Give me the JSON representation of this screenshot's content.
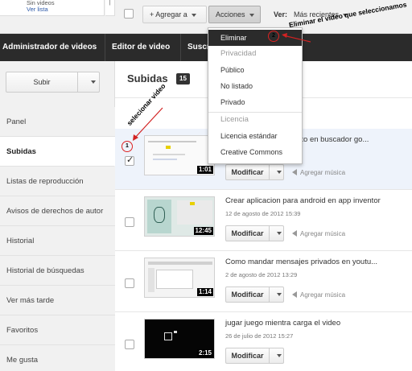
{
  "top_left": {
    "line1": "Sin videos",
    "line2": "Ver lista"
  },
  "toolbar": {
    "add_label": "+ Agregar a",
    "actions_label": "Acciones",
    "view_label": "Ver:",
    "sort_label": "Más recientes"
  },
  "nav": {
    "items": [
      "Administrador de videos",
      "Editor de video",
      "Suscr"
    ]
  },
  "sidebar": {
    "upload_label": "Subir",
    "items": [
      "Panel",
      "Subidas",
      "Listas de reproducción",
      "Avisos de derechos de autor",
      "Historial",
      "Historial de búsquedas",
      "Ver más tarde",
      "Favoritos",
      "Me gusta"
    ],
    "active_index": 1
  },
  "main": {
    "title": "Subidas",
    "count": "15",
    "videos": [
      {
        "title": "ulto en buscador go...",
        "date": "",
        "duration": "1:01",
        "modify_label": "Modificar",
        "music_label": "Agregar música",
        "checked": true
      },
      {
        "title": "Crear aplicacion para android en app inventor",
        "date": "12 de agosto de 2012 15:39",
        "duration": "12:45",
        "modify_label": "Modificar",
        "music_label": "Agregar música",
        "checked": false
      },
      {
        "title": "Como mandar mensajes privados en youtu...",
        "date": "2 de agosto de 2012 13:29",
        "duration": "1:14",
        "modify_label": "Modificar",
        "music_label": "Agregar música",
        "checked": false
      },
      {
        "title": "jugar juego mientra carga el video",
        "date": "26 de julio de 2012 15:27",
        "duration": "2:15",
        "modify_label": "Modificar",
        "music_label": "Agregar música",
        "checked": false
      }
    ]
  },
  "dropdown": {
    "delete": "Eliminar",
    "privacy_header": "Privacidad",
    "public": "Público",
    "unlisted": "No listado",
    "private": "Privado",
    "license_header": "Licencia",
    "standard_license": "Licencia estándar",
    "creative_commons": "Creative Commons"
  },
  "annotations": {
    "delete_note": "Eliminar el video que seleccionamos",
    "select_note": "selecionar video",
    "step1": "1",
    "step2": "2",
    "color": "#d22222"
  }
}
